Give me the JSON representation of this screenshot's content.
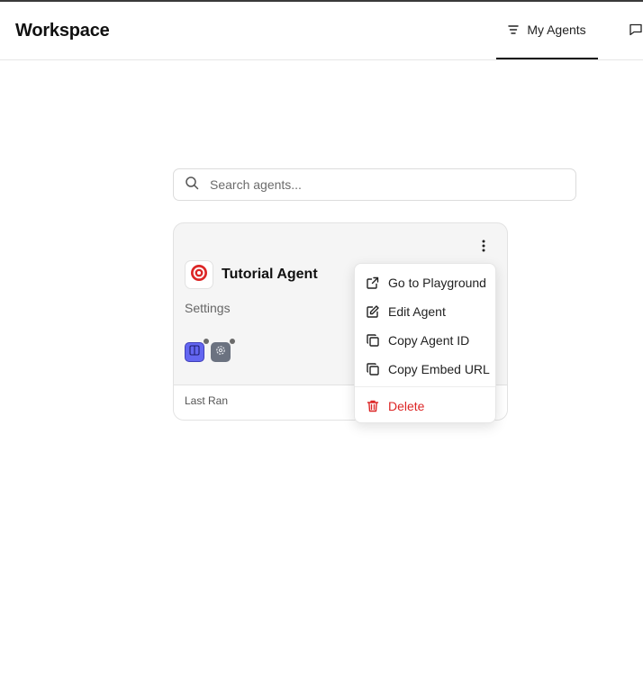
{
  "header": {
    "title": "Workspace",
    "tabs": [
      {
        "label": "My Agents",
        "active": true
      },
      {
        "label": ""
      }
    ]
  },
  "search": {
    "placeholder": "Search agents..."
  },
  "card": {
    "name": "Tutorial Agent",
    "description": "Settings",
    "footer_label": "Last Ran",
    "tools": [
      {
        "icon": "book-icon",
        "color": "#6366f1"
      },
      {
        "icon": "gear-icon",
        "color": "#6b7280"
      }
    ]
  },
  "menu": {
    "items": [
      {
        "label": "Go to Playground",
        "icon": "external-link-icon"
      },
      {
        "label": "Edit Agent",
        "icon": "edit-icon"
      },
      {
        "label": "Copy Agent ID",
        "icon": "copy-icon"
      },
      {
        "label": "Copy Embed URL",
        "icon": "copy-icon"
      },
      {
        "label": "Delete",
        "icon": "trash-icon",
        "color": "#dc2626"
      }
    ]
  },
  "colors": {
    "accent": "#111111",
    "danger": "#dc2626",
    "agent_icon": "#dc2626"
  }
}
